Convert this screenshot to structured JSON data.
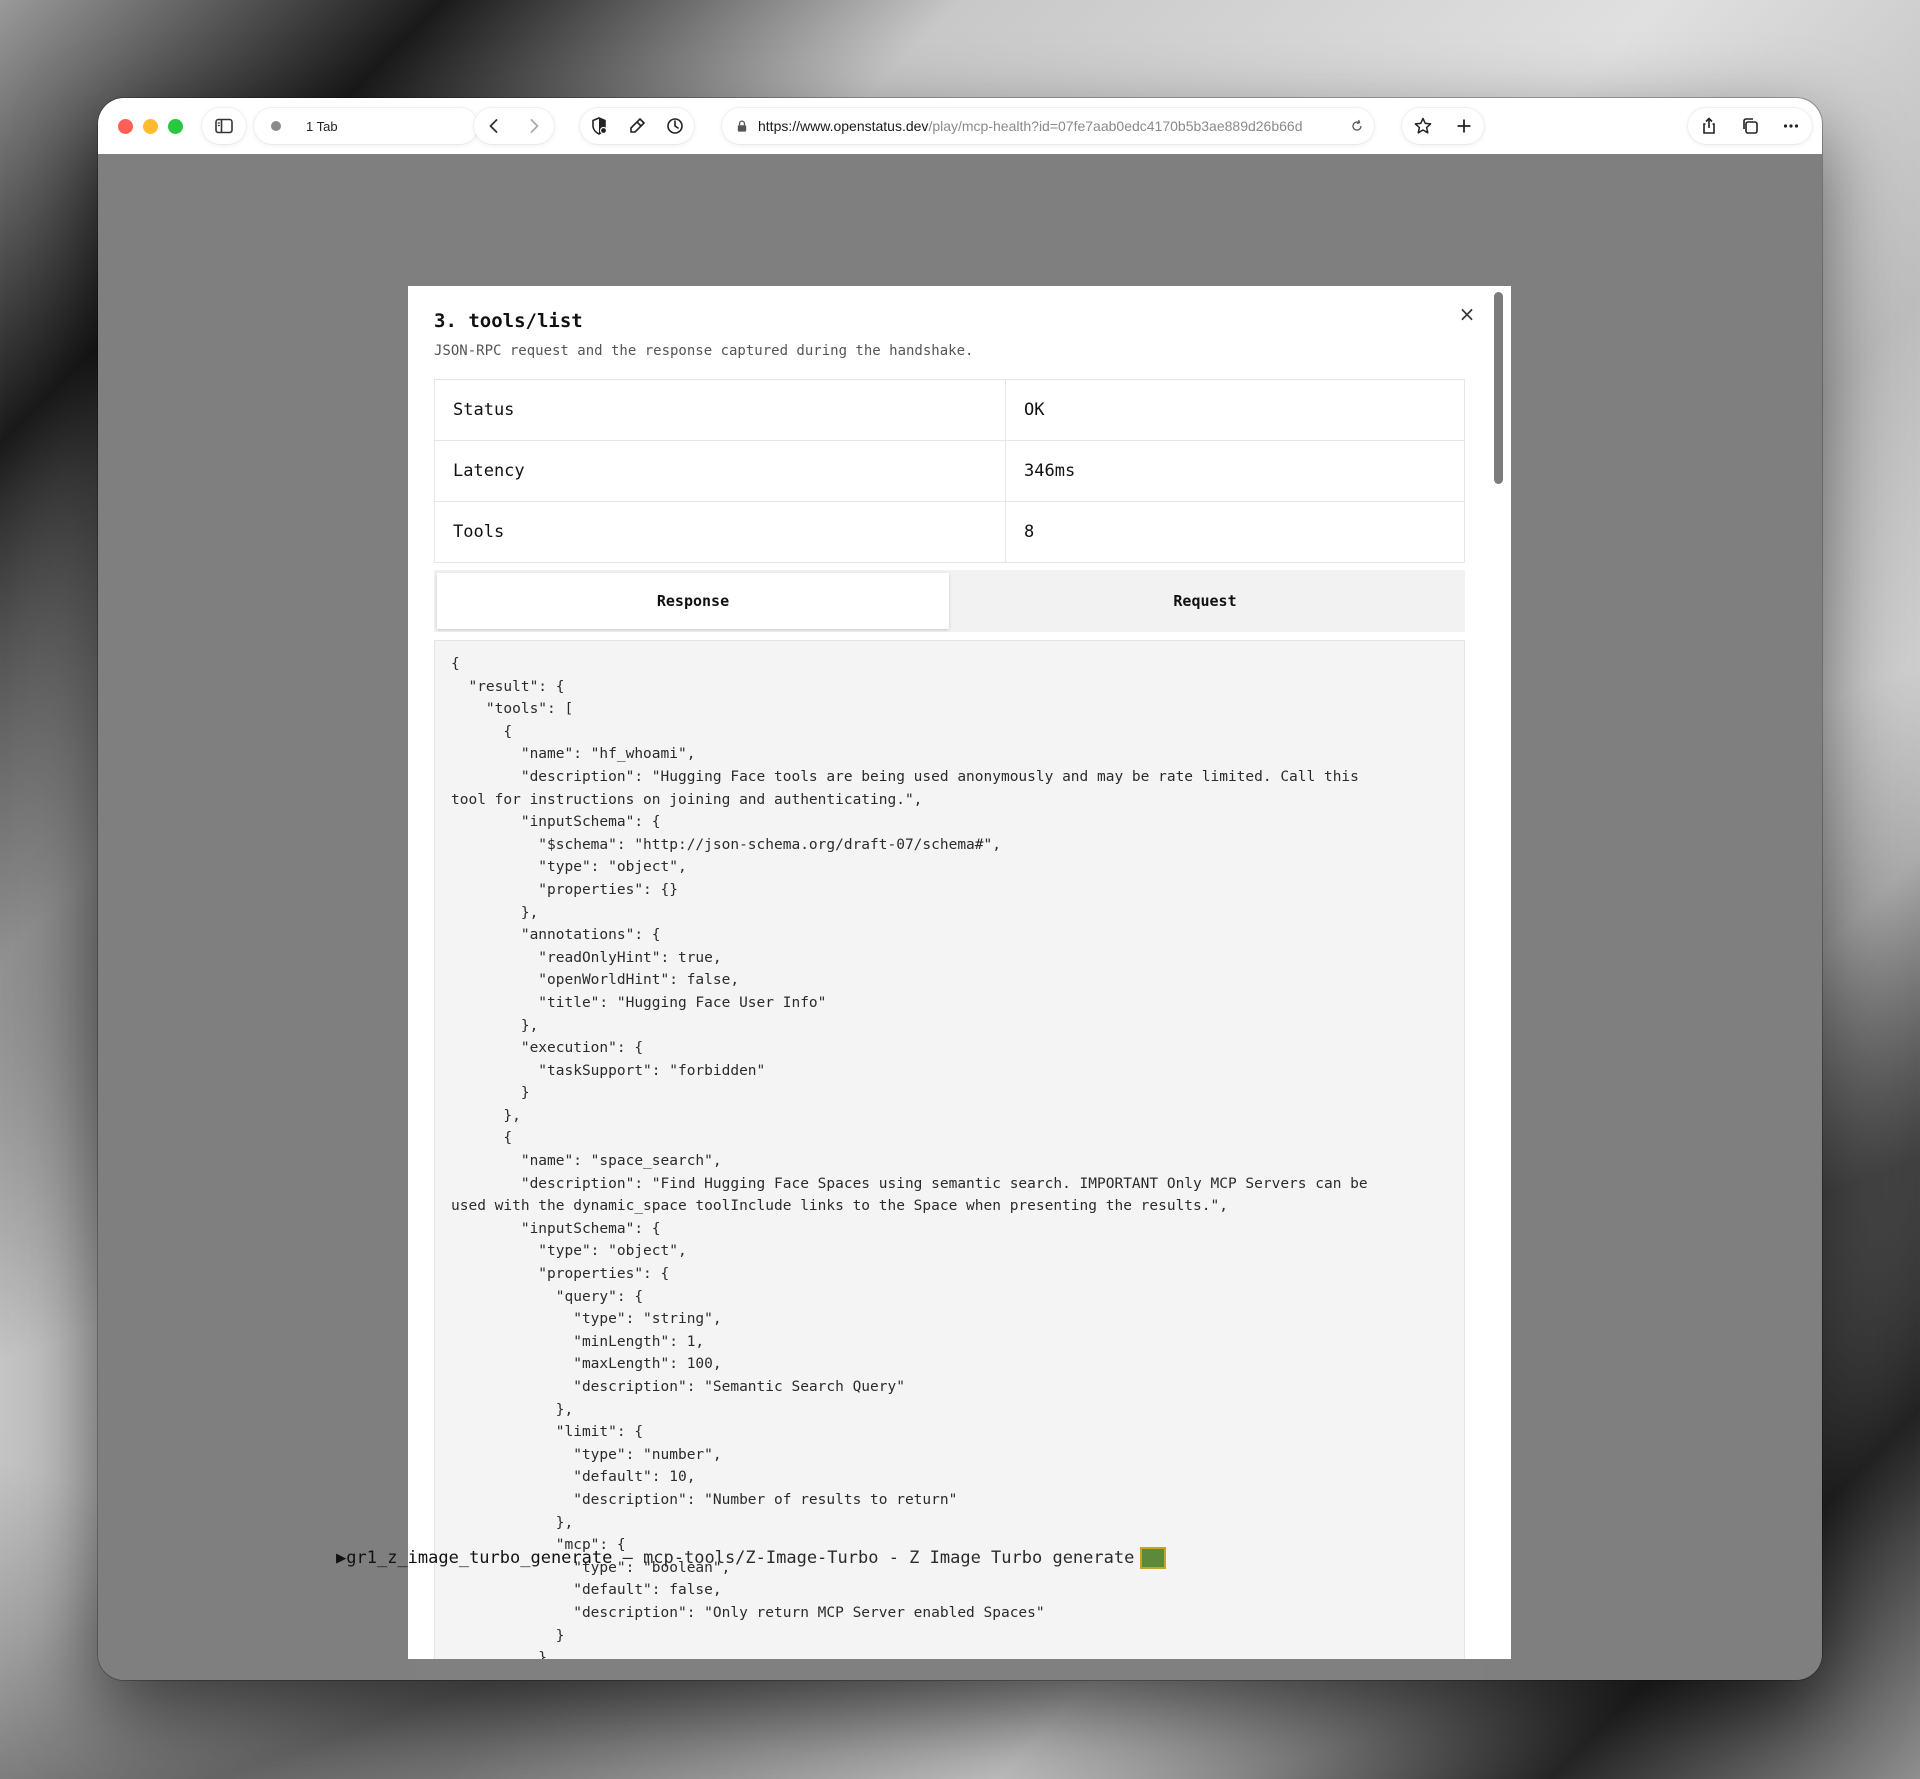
{
  "browser": {
    "tab_count_label": "1 Tab",
    "url_host": "https://www.openstatus.dev",
    "url_path": "/play/mcp-health?id=07fe7aab0edc4170b5b3ae889d26b66d"
  },
  "modal": {
    "title": "3. tools/list",
    "subtitle": "JSON-RPC request and the response captured during the handshake.",
    "close_icon": "×",
    "rows": [
      {
        "key": "Status",
        "value": "OK"
      },
      {
        "key": "Latency",
        "value": "346ms"
      },
      {
        "key": "Tools",
        "value": "8"
      }
    ],
    "tabs": {
      "response": "Response",
      "request": "Request",
      "active": "response"
    },
    "code": "{\n  \"result\": {\n    \"tools\": [\n      {\n        \"name\": \"hf_whoami\",\n        \"description\": \"Hugging Face tools are being used anonymously and may be rate limited. Call this\ntool for instructions on joining and authenticating.\",\n        \"inputSchema\": {\n          \"$schema\": \"http://json-schema.org/draft-07/schema#\",\n          \"type\": \"object\",\n          \"properties\": {}\n        },\n        \"annotations\": {\n          \"readOnlyHint\": true,\n          \"openWorldHint\": false,\n          \"title\": \"Hugging Face User Info\"\n        },\n        \"execution\": {\n          \"taskSupport\": \"forbidden\"\n        }\n      },\n      {\n        \"name\": \"space_search\",\n        \"description\": \"Find Hugging Face Spaces using semantic search. IMPORTANT Only MCP Servers can be\nused with the dynamic_space toolInclude links to the Space when presenting the results.\",\n        \"inputSchema\": {\n          \"type\": \"object\",\n          \"properties\": {\n            \"query\": {\n              \"type\": \"string\",\n              \"minLength\": 1,\n              \"maxLength\": 100,\n              \"description\": \"Semantic Search Query\"\n            },\n            \"limit\": {\n              \"type\": \"number\",\n              \"default\": 10,\n              \"description\": \"Number of results to return\"\n            },\n            \"mcp\": {\n              \"type\": \"boolean\",\n              \"default\": false,\n              \"description\": \"Only return MCP Server enabled Spaces\"\n            }\n          },"
  },
  "background_row": {
    "marker": "▶",
    "name": "gr1_z_image_turbo_generate",
    "rest": " — mcp-tools/Z-Image-Turbo - Z Image Turbo generate"
  }
}
